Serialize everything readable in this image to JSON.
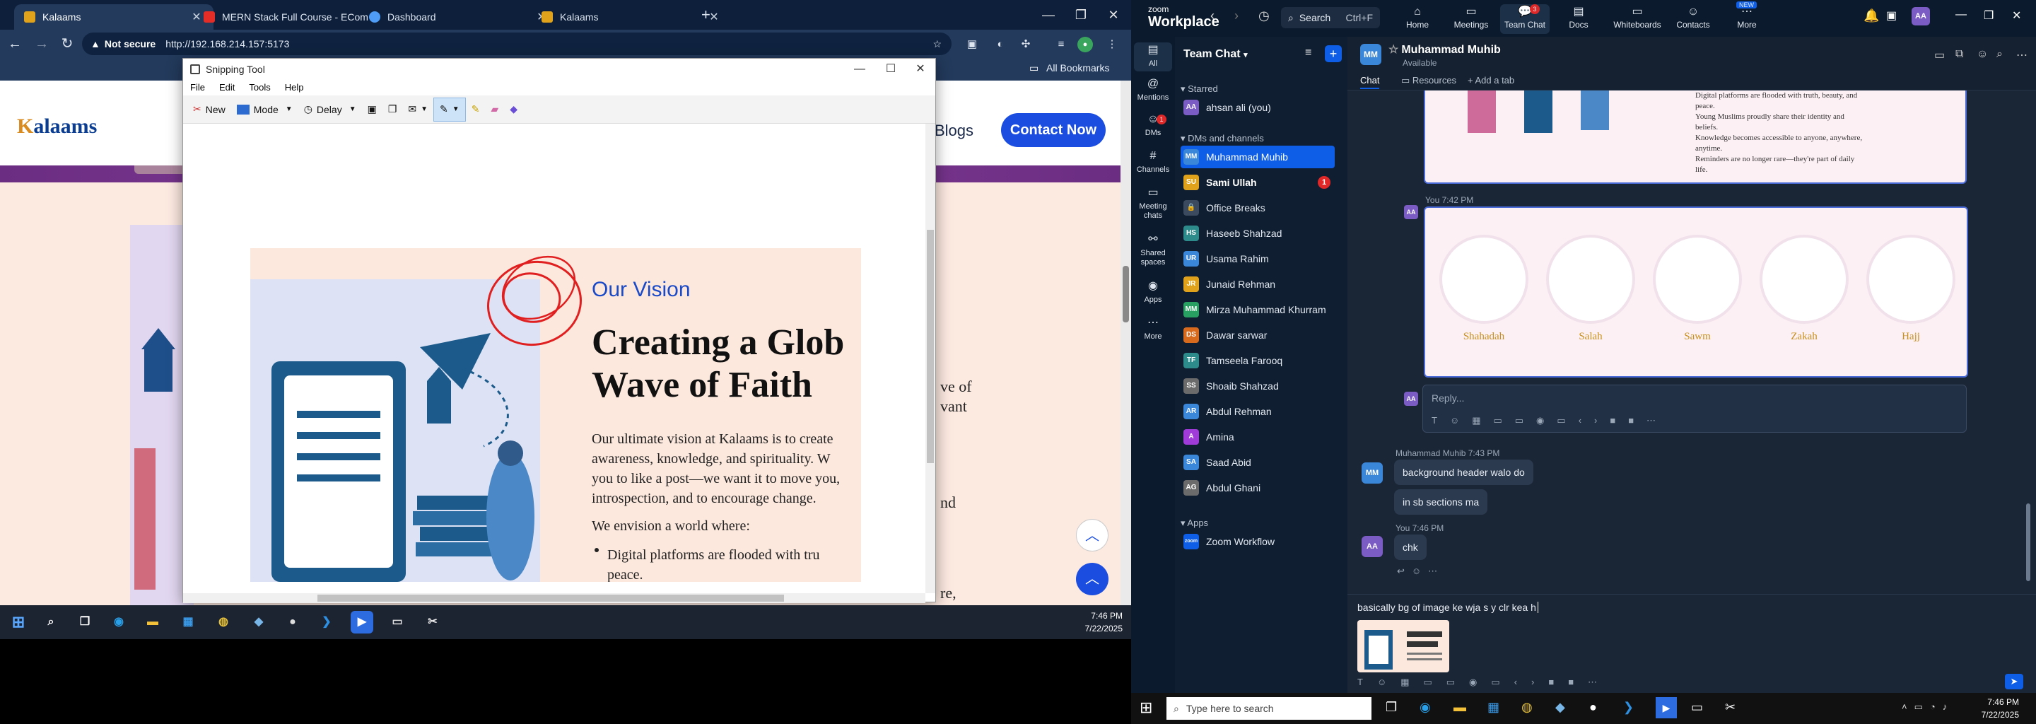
{
  "browser": {
    "tabs": [
      {
        "title": "Kalaams",
        "fav_color": "#e0a21b"
      },
      {
        "title": "MERN Stack Full Course - ECom",
        "fav_color": "#e52d27"
      },
      {
        "title": "Dashboard",
        "fav_color": "#4e9cf5"
      },
      {
        "title": "Kalaams",
        "fav_color": "#e0a21b"
      }
    ],
    "new_tab": "+",
    "not_secure": "Not secure",
    "url": "http://192.168.214.157:5173",
    "all_bookmarks": "All Bookmarks"
  },
  "site": {
    "logo_k": "K",
    "logo_rest": "alaams",
    "nav_blogs": "Blogs",
    "contact": "Contact Now",
    "bg_texts": [
      "ve of",
      "vant",
      "nd",
      "re,"
    ]
  },
  "snipping_tool": {
    "title": "Snipping Tool",
    "menu": [
      "File",
      "Edit",
      "Tools",
      "Help"
    ],
    "tools": {
      "new": "New",
      "mode": "Mode",
      "delay": "Delay"
    },
    "capture": {
      "kicker": "Our Vision",
      "heading": "Creating a Glob\nWave of Faith",
      "body": "Our ultimate vision at Kalaams is to create\nawareness, knowledge, and spirituality. W\nyou to like a post—we want it to move you,\nintrospection, and to encourage change.",
      "envision": "We envision a world where:",
      "bullet": "Digital platforms are flooded with tru\npeace."
    }
  },
  "taskbar_left": {
    "time": "7:46 PM",
    "date": "7/22/2025"
  },
  "taskbar_right": {
    "search_placeholder": "Type here to search",
    "time": "7:46 PM",
    "date": "7/22/2025"
  },
  "zoom": {
    "brand_top": "zoom",
    "brand": "Workplace",
    "search": "Search",
    "search_shortcut": "Ctrl+F",
    "nav": [
      {
        "label": "Home",
        "icon": "home-icon"
      },
      {
        "label": "Meetings",
        "icon": "video-icon"
      },
      {
        "label": "Team Chat",
        "icon": "chat-icon",
        "badge": "3"
      },
      {
        "label": "Docs",
        "icon": "doc-icon"
      },
      {
        "label": "Whiteboards",
        "icon": "whiteboard-icon"
      },
      {
        "label": "Contacts",
        "icon": "contacts-icon"
      },
      {
        "label": "More",
        "icon": "more-icon",
        "tag": "NEW"
      }
    ],
    "rail": [
      {
        "label": "All"
      },
      {
        "label": "Mentions"
      },
      {
        "label": "DMs",
        "badge": "1"
      },
      {
        "label": "Channels"
      },
      {
        "label": "Meeting chats"
      },
      {
        "label": "Shared spaces"
      },
      {
        "label": "Apps"
      },
      {
        "label": "More"
      }
    ],
    "list_title": "Team Chat",
    "section_starred": "Starred",
    "starred": [
      {
        "name": "ahsan ali (you)",
        "initials": "AA",
        "color": "#7b5bc4"
      }
    ],
    "section_dms": "DMs and channels",
    "contacts": [
      {
        "name": "Muhammad Muhib",
        "initials": "MM",
        "color": "#3a86d8",
        "selected": true
      },
      {
        "name": "Sami Ullah",
        "initials": "SU",
        "color": "#e0a21b",
        "bold": true,
        "badge": "1"
      },
      {
        "name": "Office Breaks",
        "initials": "🔒",
        "color": "#3b4a5e"
      },
      {
        "name": "Haseeb Shahzad",
        "initials": "HS",
        "color": "#2e8b8b"
      },
      {
        "name": "Usama Rahim",
        "initials": "UR",
        "color": "#3a86d8"
      },
      {
        "name": "Junaid Rehman",
        "initials": "JR",
        "color": "#e0a21b"
      },
      {
        "name": "Mirza Muhammad Khurram",
        "initials": "MM",
        "color": "#27a061"
      },
      {
        "name": "Dawar sarwar",
        "initials": "DS",
        "color": "#d86a1e"
      },
      {
        "name": "Tamseela Farooq",
        "initials": "TF",
        "color": "#2e8b8b"
      },
      {
        "name": "Shoaib Shahzad",
        "initials": "SS",
        "color": "#6b6b6b"
      },
      {
        "name": "Abdul Rehman",
        "initials": "AR",
        "color": "#3a86d8"
      },
      {
        "name": "Amina",
        "initials": "A",
        "color": "#a03ad8"
      },
      {
        "name": "Saad Abid",
        "initials": "SA",
        "color": "#3a86d8"
      },
      {
        "name": "Abdul Ghani",
        "initials": "AG",
        "color": "#6b6b6b"
      }
    ],
    "section_apps": "Apps",
    "apps": [
      {
        "name": "Zoom Workflow",
        "initials": "zoom",
        "color": "#0e5ee8"
      }
    ],
    "chat": {
      "peer_name": "Muhammad Muhib",
      "peer_initials": "MM",
      "peer_status": "Available",
      "tabs": [
        "Chat",
        "Resources",
        "+ Add a tab"
      ],
      "card_top_lines": [
        "Digital platforms are flooded with truth, beauty, and",
        "peace.",
        "Young Muslims proudly share their identity and",
        "beliefs.",
        "Knowledge becomes accessible to anyone, anywhere,",
        "anytime.",
        "Reminders are no longer rare—they're part of daily",
        "life."
      ],
      "msg1_meta": "You 7:42 PM",
      "pillars": [
        "Shahadah",
        "Salah",
        "Sawm",
        "Zakah",
        "Hajj"
      ],
      "reply_placeholder": "Reply...",
      "msg2_meta": "Muhammad Muhib 7:43 PM",
      "msg2_lines": [
        "background header walo do",
        "in sb sections ma"
      ],
      "msg3_meta": "You 7:46 PM",
      "msg3_text": "chk",
      "composer_text": "basically bg of image ke wja s y clr kea h"
    }
  }
}
